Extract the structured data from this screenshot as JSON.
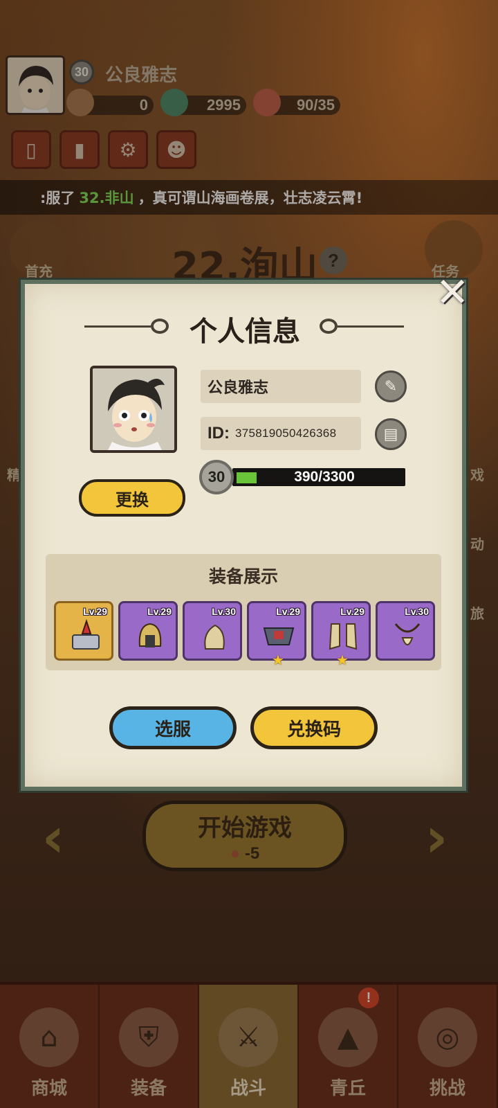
{
  "header": {
    "player_level": "30",
    "player_name": "公良雅志",
    "currency_1": "0",
    "currency_2": "2995",
    "stamina": "90/35",
    "tool_icons": [
      "scroll-icon",
      "ranking-icon",
      "settings-gear-icon",
      "friends-icon"
    ]
  },
  "ticker": {
    "prefix": ":服了",
    "highlight": "32.非山",
    "suffix": "，真可谓山海画卷展，壮志凌云霄!"
  },
  "side": {
    "left_top_label": "首充",
    "right_top_label": "任务",
    "left_mid_label": "精",
    "right_labels": [
      "戏",
      "动",
      "旅"
    ]
  },
  "stage": {
    "title": "22.洵山",
    "help": "?"
  },
  "start": {
    "label": "开始游戏",
    "cost": "-5"
  },
  "nav": {
    "tabs": [
      {
        "label": "商城",
        "icon": "shop-icon"
      },
      {
        "label": "装备",
        "icon": "armor-icon"
      },
      {
        "label": "战斗",
        "icon": "crossed-swords-icon"
      },
      {
        "label": "青丘",
        "icon": "mountain-icon"
      },
      {
        "label": "挑战",
        "icon": "challenge-icon"
      }
    ],
    "alert": "!"
  },
  "modal": {
    "title": "个人信息",
    "close": "✕",
    "change_avatar_label": "更换",
    "name": "公良雅志",
    "id_label": "ID:",
    "id_value": "375819050426368",
    "level": "30",
    "xp_text": "390/3300",
    "xp_fraction": 0.118,
    "equip_title": "装备展示",
    "equipment": [
      {
        "level": "Lv.29",
        "rarity": "gold",
        "icon": "weapon-box-icon",
        "star": false
      },
      {
        "level": "Lv.29",
        "rarity": "purple",
        "icon": "helmet-icon",
        "star": false
      },
      {
        "level": "Lv.30",
        "rarity": "purple",
        "icon": "gauntlet-icon",
        "star": false
      },
      {
        "level": "Lv.29",
        "rarity": "purple",
        "icon": "belt-icon",
        "star": true
      },
      {
        "level": "Lv.29",
        "rarity": "purple",
        "icon": "boots-icon",
        "star": true
      },
      {
        "level": "Lv.30",
        "rarity": "purple",
        "icon": "necklace-icon",
        "star": false
      }
    ],
    "select_server_label": "选服",
    "redeem_code_label": "兑换码"
  },
  "colors": {
    "modal_border": "#5e7060",
    "gold_button": "#f2c53a",
    "blue_button": "#58b4e4",
    "xp_fill": "#6ac43a",
    "purple_slot": "#9a6ac8",
    "gold_slot": "#e5b448",
    "ticker_highlight": "#7ee05a"
  }
}
